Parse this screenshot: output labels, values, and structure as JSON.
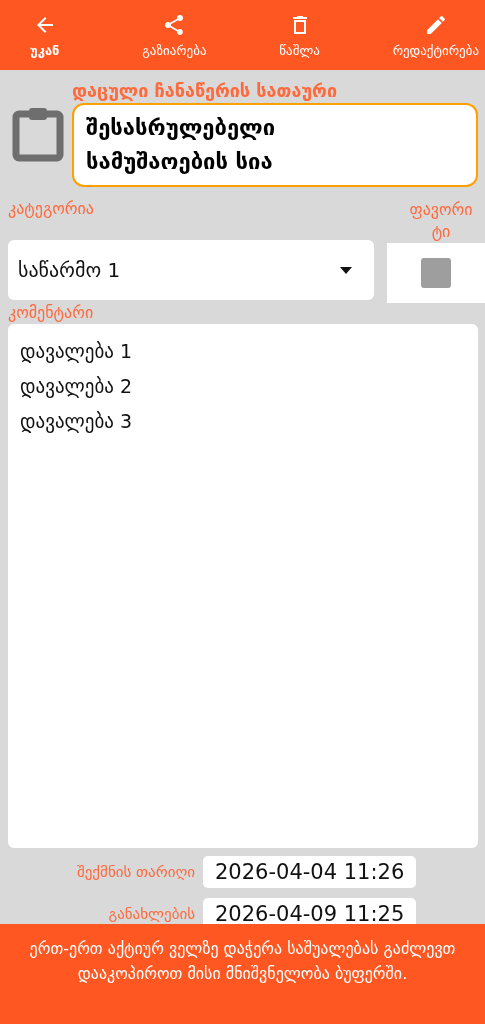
{
  "toolbar": {
    "actions": [
      {
        "kind": "back",
        "label": "უკან",
        "selected": true
      },
      {
        "kind": "share",
        "label": "გაზიარება",
        "selected": false
      },
      {
        "kind": "delete",
        "label": "წაშლა",
        "selected": false
      },
      {
        "kind": "edit",
        "label": "რედაქტირება",
        "selected": false
      }
    ]
  },
  "record": {
    "title_label": "დაცული ჩანაწერის სათაური",
    "title": "შესასრულებელი სამუშაოების სია",
    "category_label": "კატეგორია",
    "category": "საწარმო 1",
    "favorite_label": "ფავორიტი",
    "favorite": {
      "checked": false
    },
    "comment_label": "კომენტარი",
    "comment_lines": [
      "დავალება 1",
      "დავალება 2",
      "დავალება 3"
    ],
    "dates": [
      {
        "label": "შექმნის თარიღი",
        "value": "2026-04-04 11:26"
      },
      {
        "label": "განახლების",
        "value": "2026-04-09 11:25"
      }
    ]
  },
  "toast": "ერთ-ერთ აქტიურ ველზე დაჭერა საშუალებას გაძლევთ დააკოპიროთ მისი მნიშვნელობა ბუფერში."
}
